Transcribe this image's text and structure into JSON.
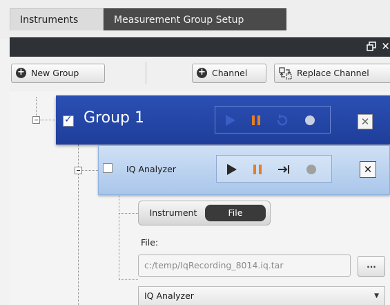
{
  "tabs": [
    {
      "label": "Instruments",
      "active": false
    },
    {
      "label": "Measurement Group Setup",
      "active": true
    }
  ],
  "toolbar": {
    "new_group_label": "New Group",
    "channel_label": "Channel",
    "replace_channel_label": "Replace Channel"
  },
  "group": {
    "title": "Group 1",
    "checked": true
  },
  "channel": {
    "title": "IQ Analyzer",
    "checked": false
  },
  "source_toggle": {
    "options": [
      "Instrument",
      "File"
    ],
    "selected": "File"
  },
  "file": {
    "label": "File:",
    "path": "c:/temp/IqRecording_8014.iq.tar",
    "browse_label": "..."
  },
  "application_select": {
    "value": "IQ Analyzer"
  },
  "colors": {
    "group_bar": "#1f3e9a",
    "channel_bar": "#a9c6ea",
    "play": "#e67e22",
    "pause": "#e67e22"
  }
}
